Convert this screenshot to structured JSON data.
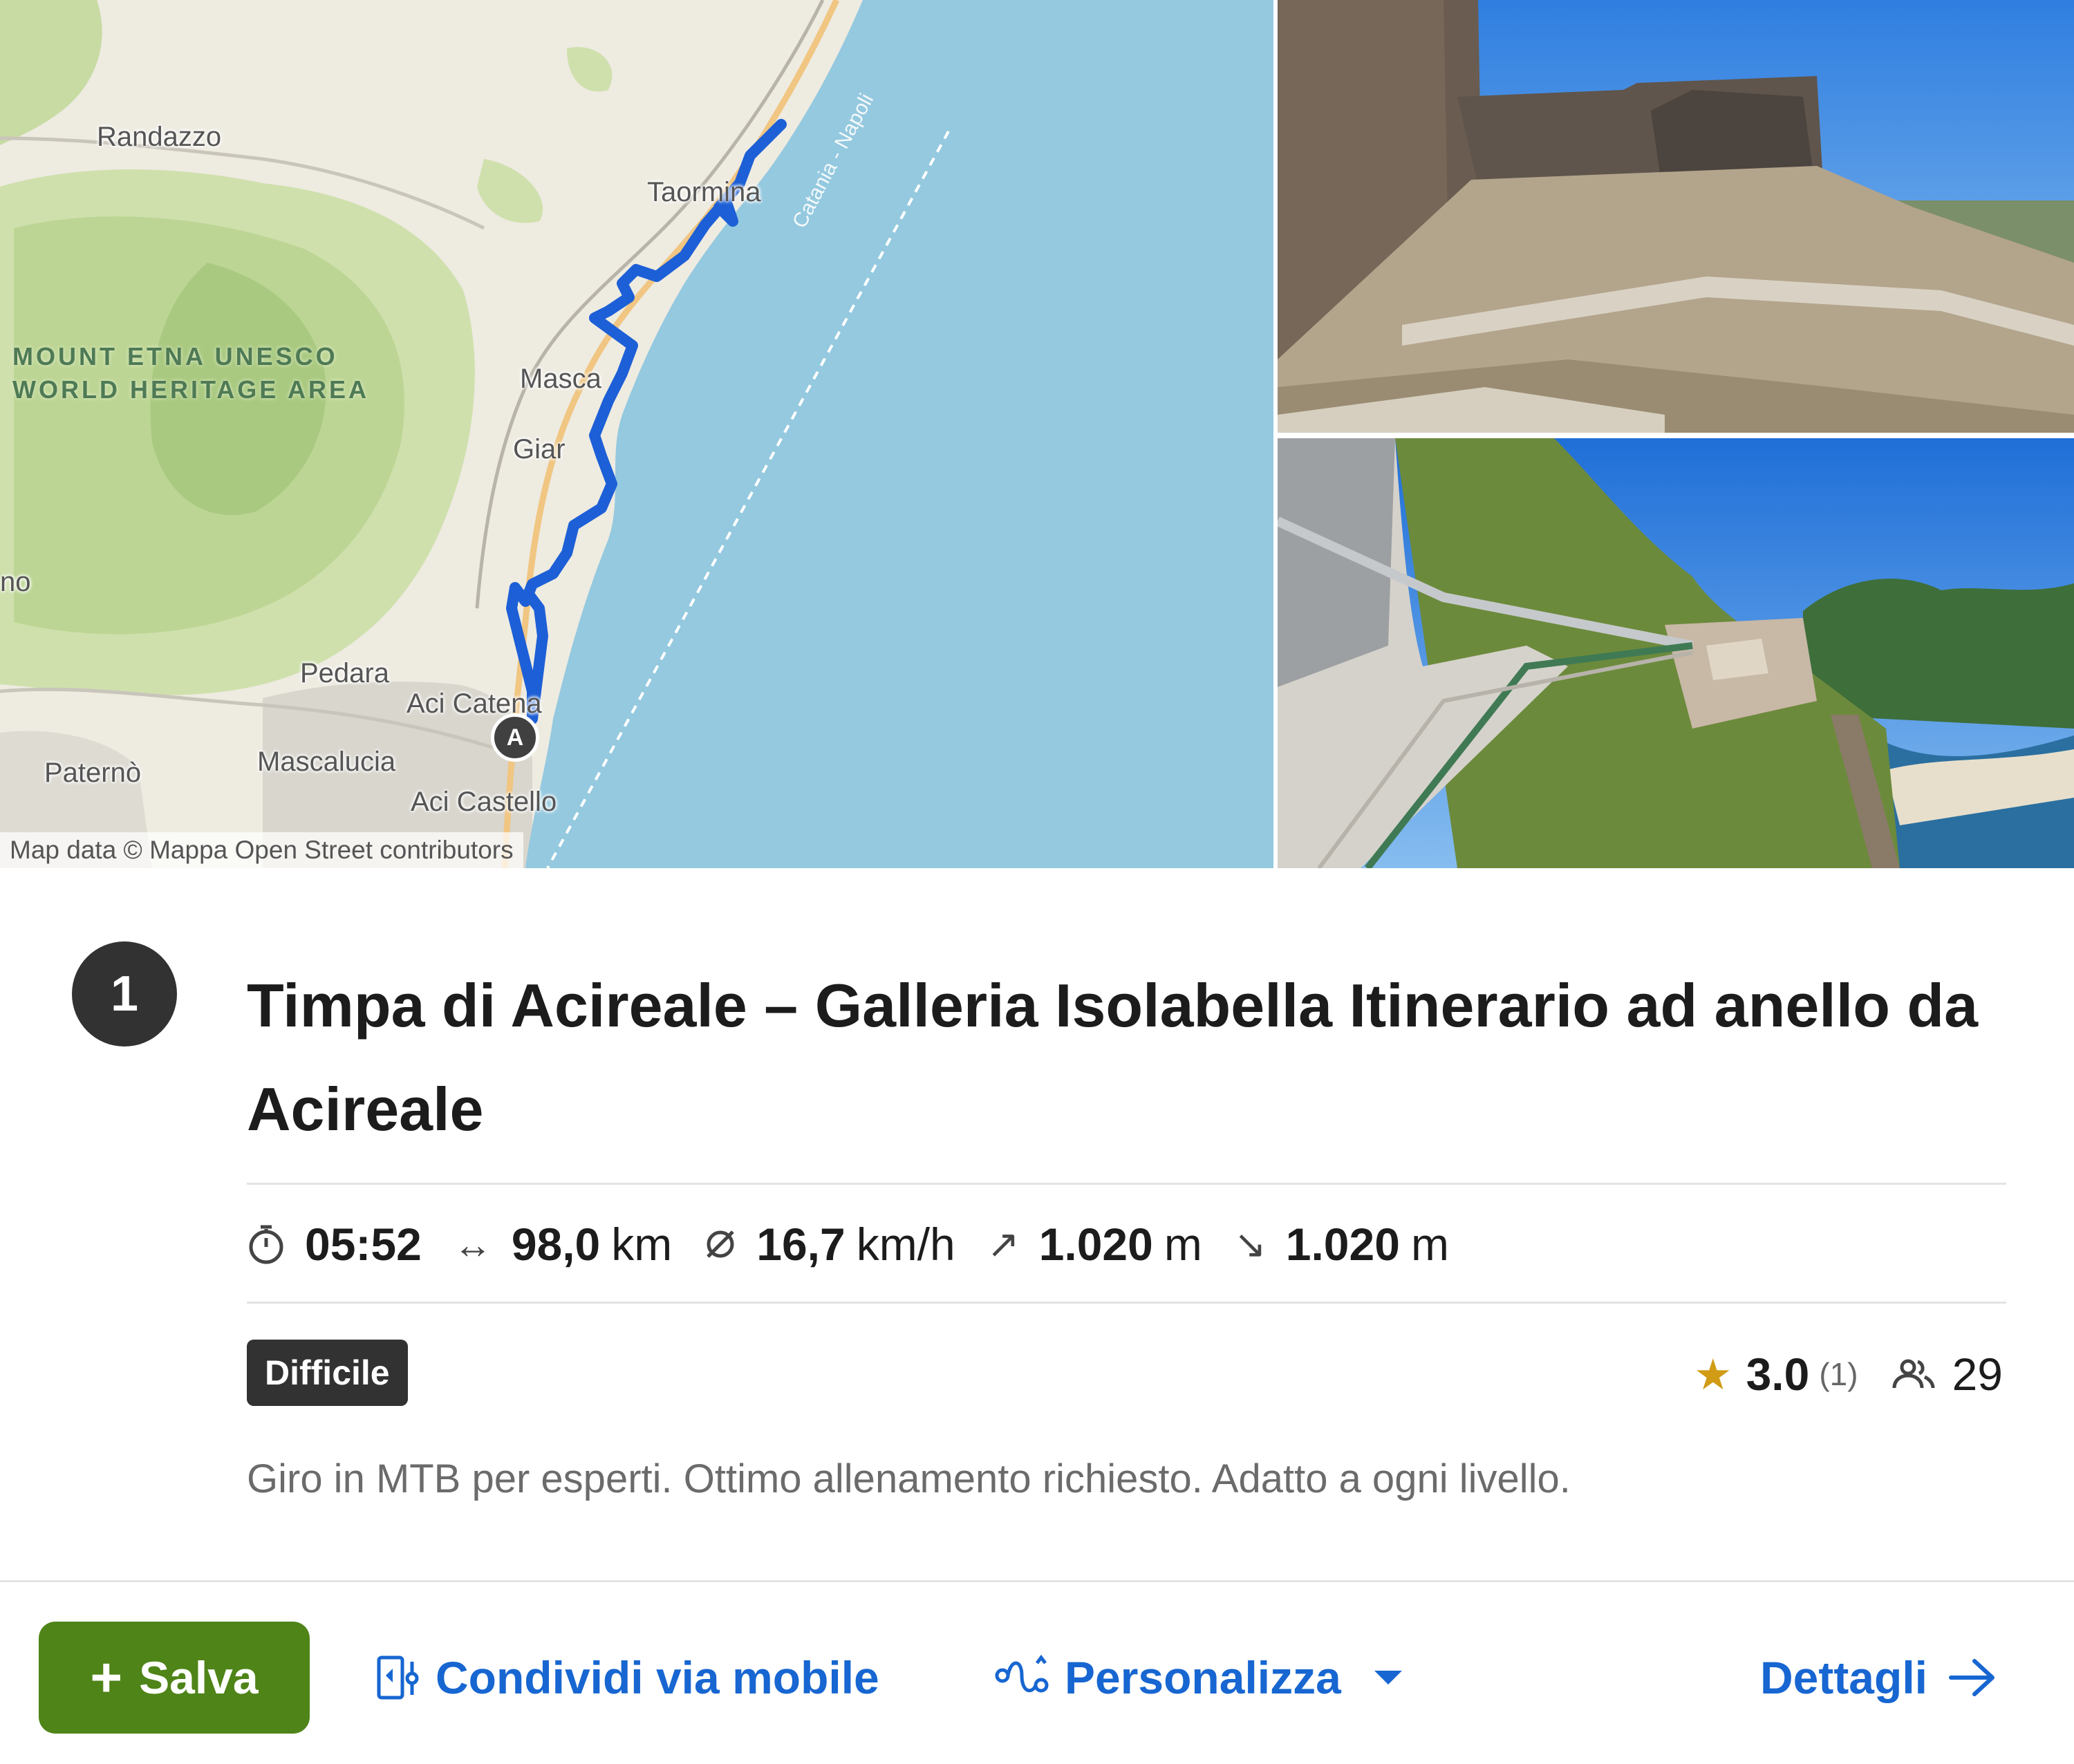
{
  "map": {
    "labels": {
      "randazzo": "Randazzo",
      "taormina": "Taormina",
      "mascali": "Masca",
      "giarre": "Giar",
      "bronte": "no",
      "pedara": "Pedara",
      "aci_catena": "Aci Catena",
      "paterno": "Paternò",
      "mascalucia": "Mascalucia",
      "aci_castello": "Aci Castello",
      "ferry_line": "Catania - Napoli"
    },
    "etna_area": [
      "MOUNT ETNA UNESCO",
      "WORLD HERITAGE AREA"
    ],
    "start_marker": "A",
    "attribution": "Map data © Mappa Open Street contributors",
    "route_color": "#1d5fd6"
  },
  "photos": {
    "top_icon": "castle-ruins-photo",
    "bottom_icon": "coastal-cycle-path-photo"
  },
  "tour": {
    "number": "1",
    "title": "Timpa di Acireale – Galleria Isolabella Itinerario ad anello da Acireale",
    "stats": {
      "duration": {
        "icon": "stopwatch-icon",
        "value": "05:52"
      },
      "distance": {
        "icon": "distance-arrows-icon",
        "value": "98,0",
        "unit": "km"
      },
      "speed": {
        "icon": "average-speed-icon",
        "value": "16,7",
        "unit": "km/h"
      },
      "ascent": {
        "icon": "ascent-arrow-icon",
        "value": "1.020",
        "unit": "m"
      },
      "descent": {
        "icon": "descent-arrow-icon",
        "value": "1.020",
        "unit": "m"
      }
    },
    "difficulty": "Difficile",
    "rating": {
      "value": "3.0",
      "count": "(1)",
      "stars": 3.0
    },
    "visitors": "29",
    "description": "Giro in MTB per esperti. Ottimo allenamento richiesto. Adatto a ogni livello."
  },
  "actions": {
    "save": "Salva",
    "share": "Condividi via mobile",
    "customize": "Personalizza",
    "details": "Dettagli"
  },
  "colors": {
    "accent_green": "#4f8418",
    "link_blue": "#1766d1",
    "badge_dark": "#323232",
    "star_gold": "#d19b15"
  }
}
